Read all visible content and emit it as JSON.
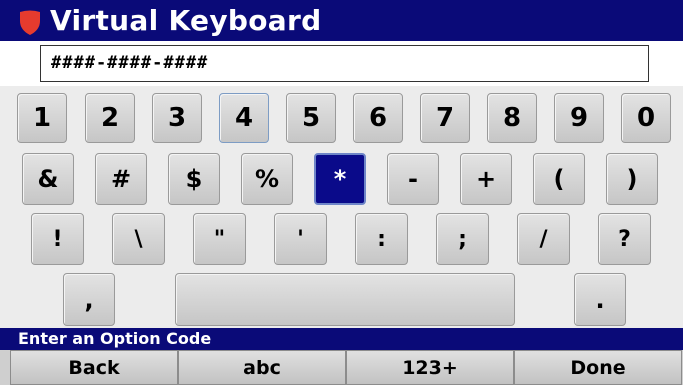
{
  "header": {
    "title": "Virtual Keyboard",
    "logo_icon": "red-shield-icon"
  },
  "display": {
    "value": "####-####-####"
  },
  "keyboard": {
    "row1": [
      "1",
      "2",
      "3",
      "4",
      "5",
      "6",
      "7",
      "8",
      "9",
      "0"
    ],
    "row2": [
      "&",
      "#",
      "$",
      "%",
      "*",
      "-",
      "+",
      "(",
      ")"
    ],
    "row3": [
      "!",
      "\\",
      "\"",
      "'",
      ":",
      ";",
      "/",
      "?"
    ],
    "row4": [
      ",",
      "",
      "."
    ],
    "selected_key": "*",
    "highlighted_key": "4"
  },
  "status": {
    "message": "Enter an Option Code"
  },
  "softkeys": [
    "Back",
    "abc",
    "123+",
    "Done"
  ],
  "colors": {
    "title_bar": "#0a0a78",
    "selected_key": "#0a0a8a",
    "logo": "#e63b2e",
    "key_face": "#d4d4d4"
  }
}
